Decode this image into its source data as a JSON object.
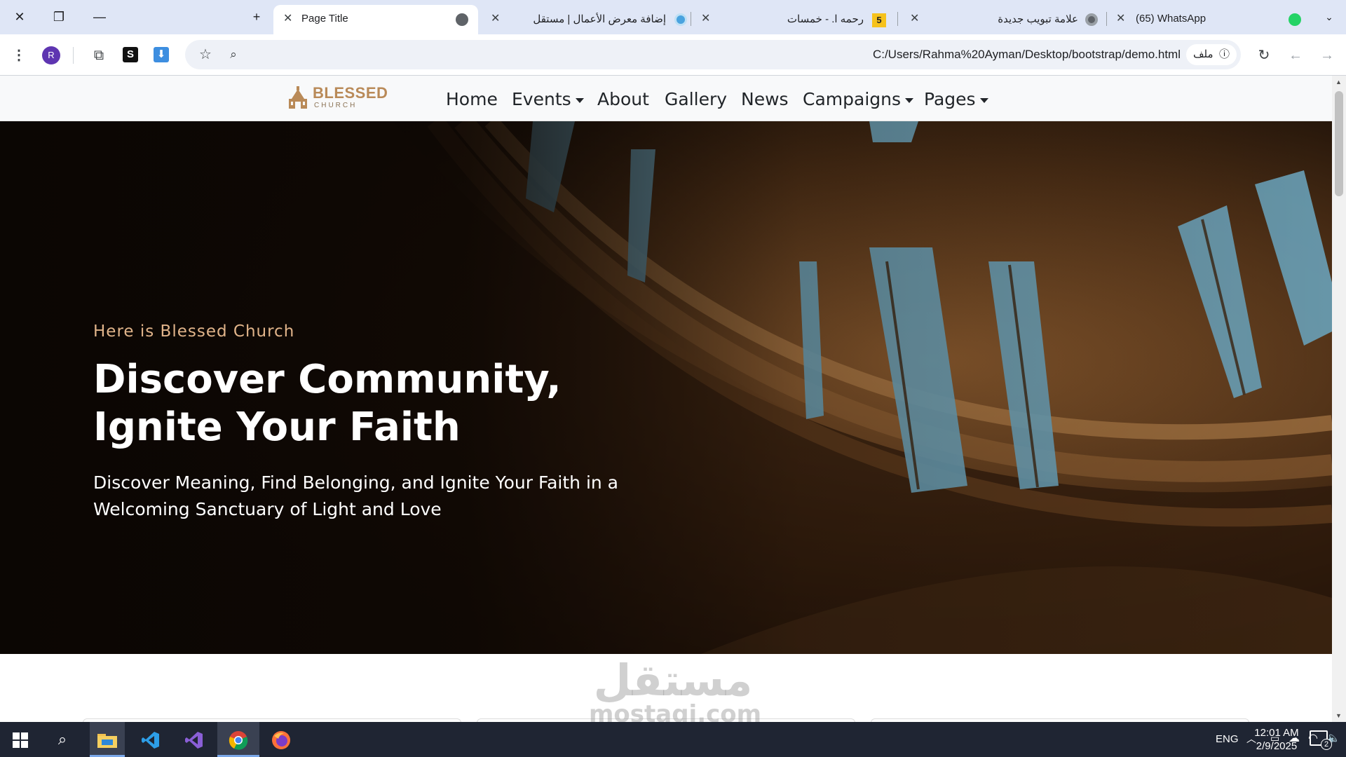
{
  "browser": {
    "tabs": [
      {
        "title": "Page Title",
        "active": true
      },
      {
        "title": "إضافة معرض الأعمال | مستقل",
        "active": false
      },
      {
        "title": "رحمه ا. - خمسات",
        "badge": "5",
        "active": false
      },
      {
        "title": "علامة تبويب جديدة",
        "active": false
      },
      {
        "title": "(65) WhatsApp",
        "active": false
      }
    ],
    "profile_initial": "R",
    "address": {
      "url": "C:/Users/Rahma%20Ayman/Desktop/bootstrap/demo.html",
      "chip_label": "ملف"
    }
  },
  "site": {
    "logo": {
      "name": "BLESSED",
      "sub": "CHURCH"
    },
    "nav": {
      "home": "Home",
      "events": "Events",
      "about": "About",
      "gallery": "Gallery",
      "news": "News",
      "campaigns": "Campaigns",
      "pages": "Pages"
    },
    "hero": {
      "tagline": "Here is Blessed Church",
      "title": "Discover Community, Ignite Your Faith",
      "subtitle": "Discover Meaning, Find Belonging, and Ignite Your Faith in a Welcoming Sanctuary of Light and Love"
    },
    "colors": {
      "accent": "#b98a58",
      "tagline": "#e1b48a",
      "hero_dark": "#120b06"
    }
  },
  "watermark": {
    "arabic": "مستقل",
    "latin": "mostaqi.com"
  },
  "taskbar": {
    "apps": [
      "start-icon",
      "search-icon",
      "file-explorer-icon",
      "vscode-icon",
      "visual-studio-icon",
      "chrome-icon",
      "firefox-icon"
    ],
    "language": "ENG",
    "time": "12:01 AM",
    "date": "2/9/2025",
    "notification_count": "2"
  }
}
